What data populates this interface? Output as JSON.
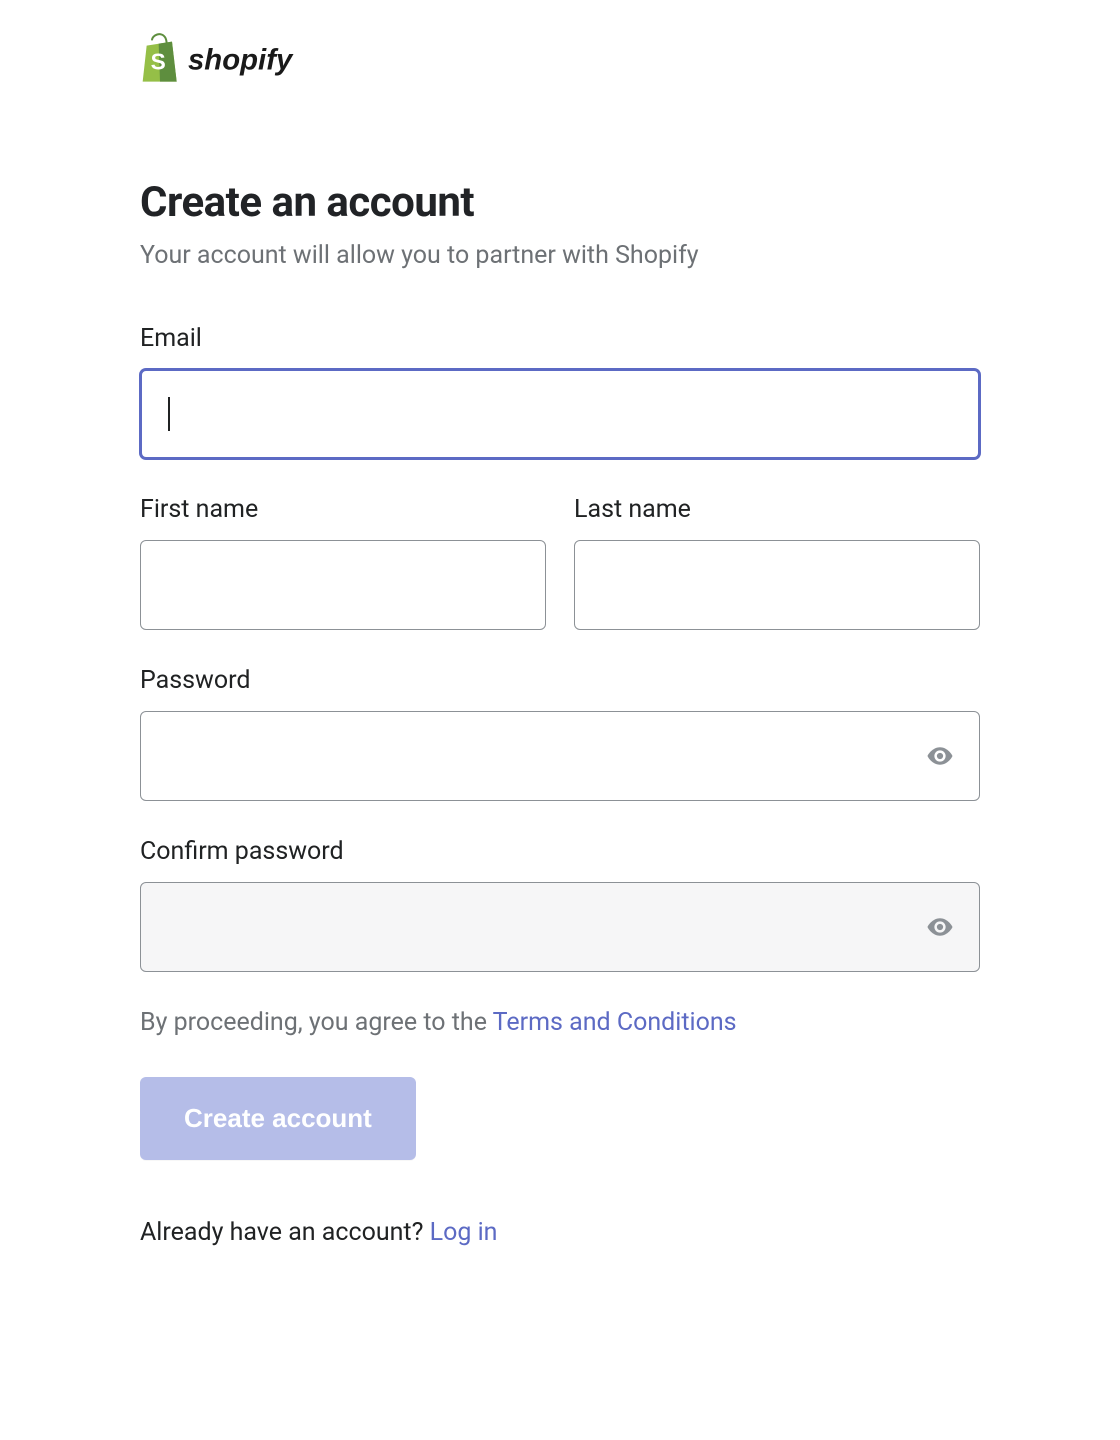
{
  "brand": {
    "name": "shopify"
  },
  "header": {
    "title": "Create an account",
    "subtitle": "Your account will allow you to partner with Shopify"
  },
  "form": {
    "email": {
      "label": "Email",
      "value": ""
    },
    "first_name": {
      "label": "First name",
      "value": ""
    },
    "last_name": {
      "label": "Last name",
      "value": ""
    },
    "password": {
      "label": "Password",
      "value": ""
    },
    "confirm_password": {
      "label": "Confirm password",
      "value": ""
    },
    "agree_prefix": "By proceeding, you agree to the ",
    "agree_link": "Terms and Conditions",
    "submit_label": "Create account"
  },
  "footer": {
    "login_prefix": "Already have an account? ",
    "login_link": "Log in"
  },
  "colors": {
    "accent": "#5c6ac4",
    "brand_green": "#95bf47",
    "brand_green_dark": "#5e8e3e",
    "text_muted": "#6d7175"
  }
}
